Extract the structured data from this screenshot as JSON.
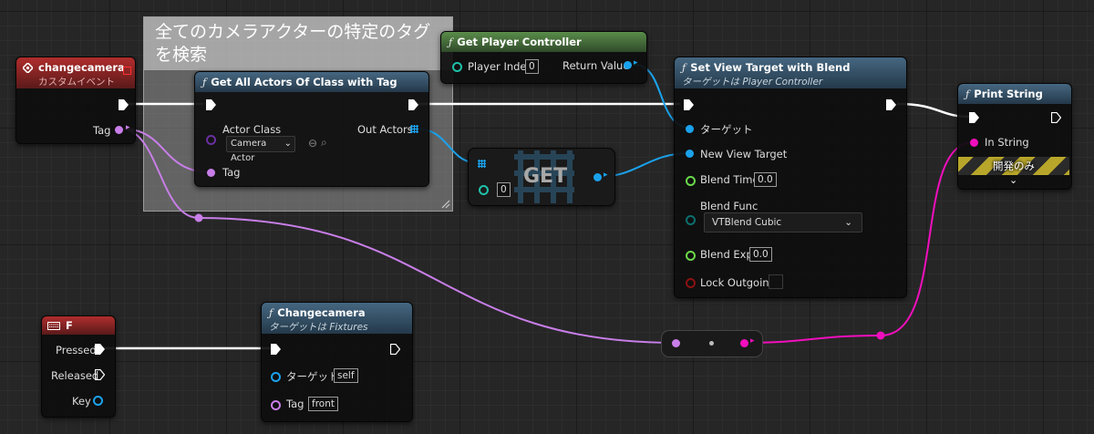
{
  "comment": {
    "text": "全てのカメラアクターの特定のタグを検索"
  },
  "event_node": {
    "title": "changecamera",
    "subtitle": "カスタムイベント",
    "tag_pin": "Tag"
  },
  "get_all_actors": {
    "title": "Get All Actors Of Class with Tag",
    "actor_class_label": "Actor Class",
    "actor_class_value": "Camera Actor",
    "tag_label": "Tag",
    "out_label": "Out Actors"
  },
  "get_player_controller": {
    "title": "Get Player Controller",
    "player_index_label": "Player Index",
    "player_index_value": "0",
    "return_label": "Return Value"
  },
  "get_node": {
    "label": "GET",
    "index_value": "0"
  },
  "set_view_target": {
    "title": "Set View Target with Blend",
    "subtitle": "ターゲットは Player Controller",
    "target_label": "ターゲット",
    "new_view_target_label": "New View Target",
    "blend_time_label": "Blend Time",
    "blend_time_value": "0.0",
    "blend_func_label": "Blend Func",
    "blend_func_value": "VTBlend Cubic",
    "blend_exp_label": "Blend Exp",
    "blend_exp_value": "0.0",
    "lock_outgoing_label": "Lock Outgoing"
  },
  "print_string": {
    "title": "Print String",
    "in_string_label": "In String",
    "dev_only_label": "開発のみ"
  },
  "key_node": {
    "title": "F",
    "pressed_label": "Pressed",
    "released_label": "Released",
    "key_label": "Key"
  },
  "changecamera_call": {
    "title": "Changecamera",
    "subtitle": "ターゲットは Fixtures",
    "target_label": "ターゲット",
    "target_value": "self",
    "tag_label": "Tag",
    "tag_value": "front"
  },
  "colors": {
    "object_pin": "#1ba2ec",
    "name_pin": "#c87ee8",
    "string_pin": "#f10fbd",
    "float_pin": "#6ad94a",
    "bool_pin": "#8c1212",
    "struct_pin": "#0d6e6e"
  }
}
